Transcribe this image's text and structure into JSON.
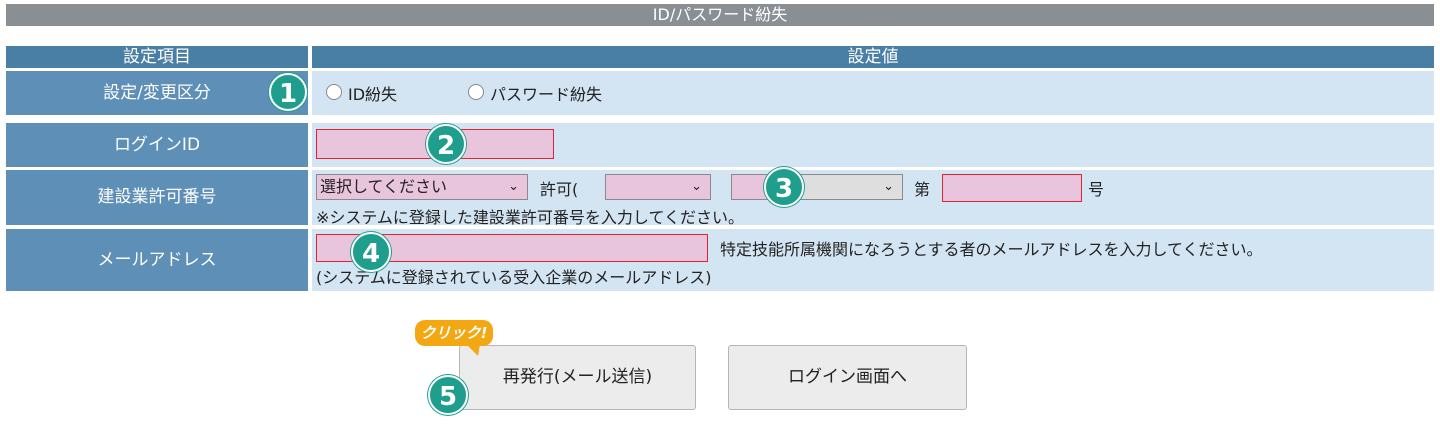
{
  "title": "ID/パスワード紛失",
  "header": {
    "col_item": "設定項目",
    "col_value": "設定値"
  },
  "rows": {
    "category": {
      "label": "設定/変更区分",
      "options": [
        "ID紛失",
        "パスワード紛失"
      ]
    },
    "login_id": {
      "label": "ログインID",
      "value": ""
    },
    "license": {
      "label": "建設業許可番号",
      "select_placeholder": "選択してください",
      "permit_prefix": "許可(",
      "no_prefix": "第",
      "no_suffix": "号",
      "note": "※システムに登録した建設業許可番号を入力してください。"
    },
    "email": {
      "label": "メールアドレス",
      "value": "",
      "hint": "特定技能所属機関になろうとする者のメールアドレスを入力してください。",
      "note": "(システムに登録されている受入企業のメールアドレス)"
    }
  },
  "buttons": {
    "reissue": "再発行(メール送信)",
    "login": "ログイン画面へ"
  },
  "callout": "クリック!",
  "badges": [
    "1",
    "2",
    "3",
    "4",
    "5"
  ],
  "icons": {
    "select_arrow": "chevron-down-icon",
    "radio": "radio-circle-icon"
  },
  "colors": {
    "header": "#4a7fa5",
    "label_cell": "#5e8fb7",
    "value_cell": "#d3e4f3",
    "required_field": "#e9c4dd",
    "badge": "#1f9e8e",
    "callout": "#f3a712"
  }
}
